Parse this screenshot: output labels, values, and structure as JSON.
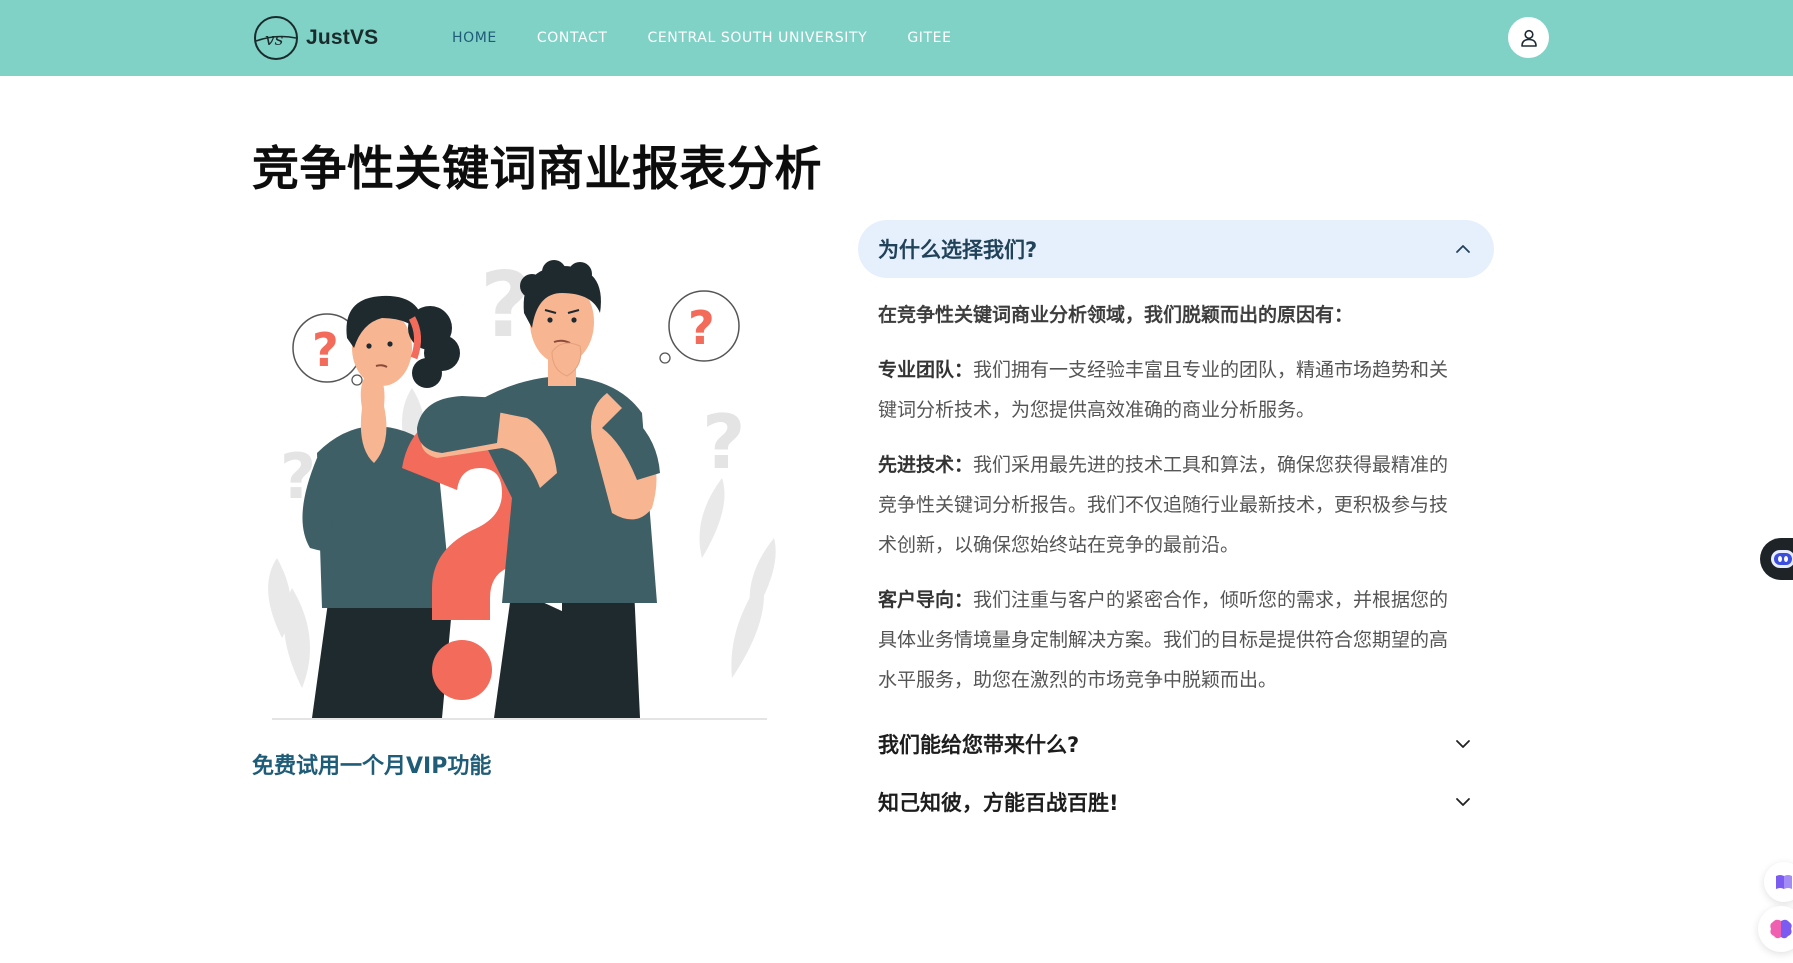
{
  "nav": {
    "brand": "JustVS",
    "logo_text": "vs",
    "links": [
      {
        "label": "HOME",
        "active": true
      },
      {
        "label": "CONTACT",
        "active": false
      },
      {
        "label": "CENTRAL SOUTH UNIVERSITY",
        "active": false
      },
      {
        "label": "GITEE",
        "active": false
      }
    ],
    "user_icon": "user-icon"
  },
  "page": {
    "title": "竞争性关键词商业报表分析",
    "trial_link": "免费试用一个月VIP功能"
  },
  "illustration": {
    "question_mark": "?"
  },
  "accordion": {
    "open": {
      "title": "为什么选择我们?",
      "intro": "在竞争性关键词商业分析领域，我们脱颖而出的原因有：",
      "items": [
        {
          "label": "专业团队：",
          "text": "我们拥有一支经验丰富且专业的团队，精通市场趋势和关键词分析技术，为您提供高效准确的商业分析服务。"
        },
        {
          "label": "先进技术：",
          "text": "我们采用最先进的技术工具和算法，确保您获得最精准的竞争性关键词分析报告。我们不仅追随行业最新技术，更积极参与技术创新，以确保您始终站在竞争的最前沿。"
        },
        {
          "label": "客户导向：",
          "text": "我们注重与客户的紧密合作，倾听您的需求，并根据您的具体业务情境量身定制解决方案。我们的目标是提供符合您期望的高水平服务，助您在激烈的市场竞争中脱颖而出。"
        }
      ]
    },
    "closed": [
      {
        "title": "我们能给您带来什么?"
      },
      {
        "title": "知己知彼，方能百战百胜!"
      }
    ]
  },
  "colors": {
    "navbar": "#80d1c6",
    "nav_active": "#1f5c78",
    "accordion_open_bg": "#e6f0fd",
    "accent_coral": "#f26b5b",
    "shirt": "#3f5f66",
    "pants": "#1f2a2e"
  }
}
